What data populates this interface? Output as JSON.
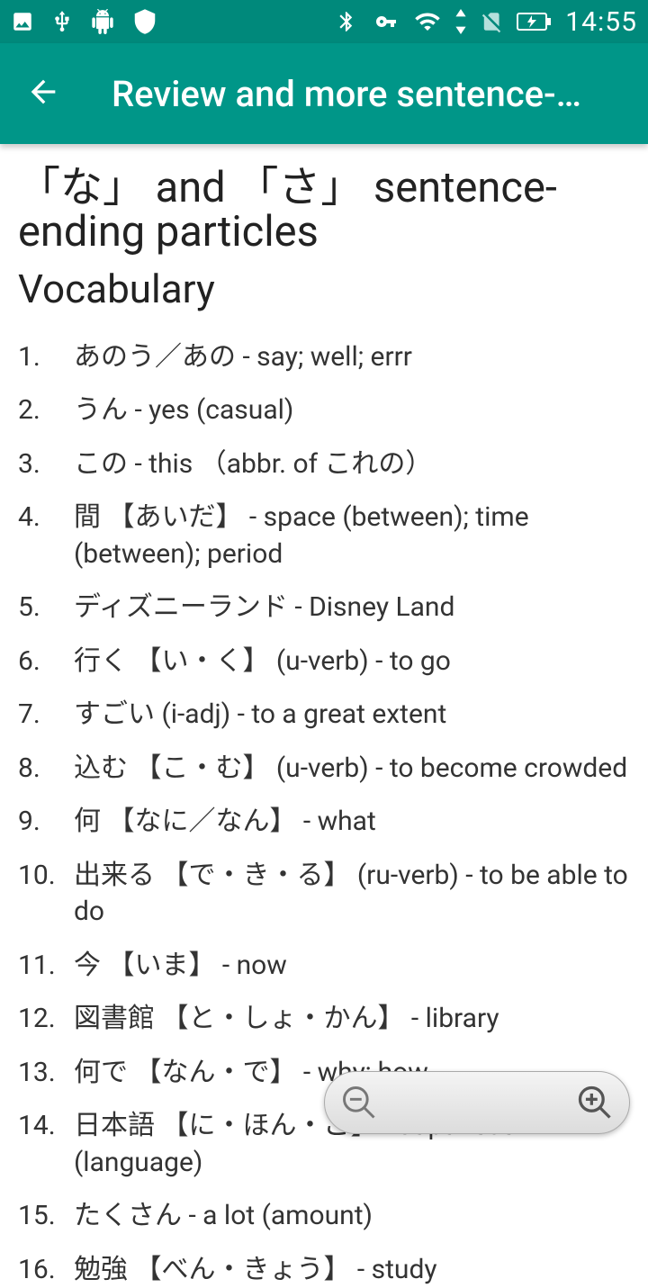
{
  "status": {
    "time": "14:55"
  },
  "appbar": {
    "title": "Review and more sentence-…"
  },
  "page": {
    "heading": "「な」 and 「さ」 sentence-ending particles",
    "section": "Vocabulary"
  },
  "vocab": [
    "あのう／あの - say; well; errr",
    "うん - yes (casual)",
    "この - this （abbr. of これの）",
    "間 【あいだ】 - space (between); time (between); period",
    "ディズニーランド - Disney Land",
    "行く 【い・く】 (u-verb) - to go",
    "すごい (i-adj) - to a great extent",
    "込む 【こ・む】 (u-verb) - to become crowded",
    "何 【なに／なん】 - what",
    "出来る 【で・き・る】 (ru-verb) - to be able to do",
    "今 【いま】 - now",
    "図書館 【と・しょ・かん】 - library",
    "何で 【なん・で】 - why; how",
    "日本語 【に・ほん・ご】 - Japanese (language)",
    "たくさん - a lot (amount)",
    "勉強 【べん・きょう】 - study"
  ]
}
